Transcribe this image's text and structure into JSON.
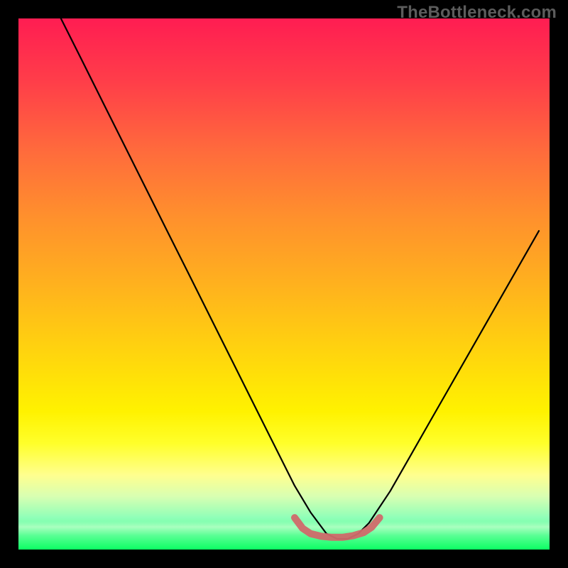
{
  "watermark": "TheBottleneck.com",
  "chart_data": {
    "type": "line",
    "title": "",
    "xlabel": "",
    "ylabel": "",
    "xlim": [
      0,
      100
    ],
    "ylim": [
      0,
      100
    ],
    "grid": false,
    "legend": false,
    "series": [
      {
        "name": "bottleneck-curve",
        "x": [
          8,
          12,
          16,
          20,
          24,
          28,
          32,
          36,
          40,
          44,
          48,
          52,
          55,
          58,
          60,
          62,
          64,
          66,
          70,
          74,
          78,
          82,
          86,
          90,
          94,
          98
        ],
        "y": [
          100,
          92,
          84,
          76,
          68,
          60,
          52,
          44,
          36,
          28,
          20,
          12,
          7,
          3,
          2,
          2,
          3,
          5,
          11,
          18,
          25,
          32,
          39,
          46,
          53,
          60
        ],
        "color": "#000000"
      },
      {
        "name": "optimal-zone",
        "x": [
          52,
          53.5,
          55,
          57,
          59,
          61,
          63,
          65,
          66.5,
          68
        ],
        "y": [
          6,
          4,
          3,
          2.5,
          2.3,
          2.3,
          2.6,
          3.2,
          4.2,
          6
        ],
        "color": "#d06a6a"
      }
    ],
    "gradient_stops": [
      {
        "pos": 0,
        "color": "#ff1d52"
      },
      {
        "pos": 25,
        "color": "#ff6b3c"
      },
      {
        "pos": 50,
        "color": "#ffb11e"
      },
      {
        "pos": 74,
        "color": "#fff200"
      },
      {
        "pos": 90,
        "color": "#d8ffb2"
      },
      {
        "pos": 100,
        "color": "#0cff63"
      }
    ]
  }
}
